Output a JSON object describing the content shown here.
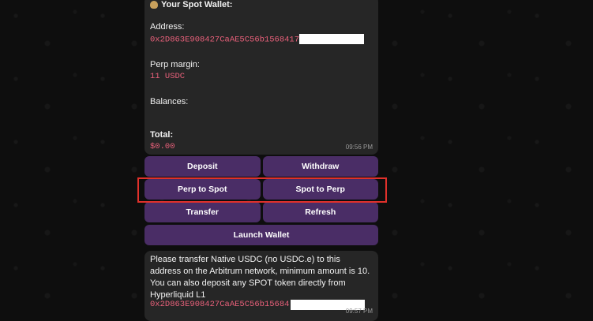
{
  "wallet_message": {
    "title": "Your Spot Wallet:",
    "address_label": "Address:",
    "address_value": "0x2D863E908427CaAE5C56b1568417",
    "perp_margin_label": "Perp margin:",
    "perp_margin_value": "11 USDC",
    "balances_label": "Balances:",
    "total_label": "Total:",
    "total_value": "$0.00",
    "time": "09:56 PM"
  },
  "keyboard": {
    "deposit": "Deposit",
    "withdraw": "Withdraw",
    "perp_to_spot": "Perp to Spot",
    "spot_to_perp": "Spot to Perp",
    "transfer": "Transfer",
    "refresh": "Refresh",
    "launch_wallet": "Launch Wallet"
  },
  "transfer_message": {
    "text": "Please transfer Native USDC (no USDC.e) to this address on the Arbitrum network, minimum amount is 10. You can also deposit any SPOT token directly from Hyperliquid L1",
    "address_value": "0x2D863E908427CaAE5C56b15684",
    "time": "09:57 PM"
  },
  "colors": {
    "button_bg": "#4a2d66",
    "mono_text": "#e8607a",
    "highlight_border": "#e0312b"
  }
}
